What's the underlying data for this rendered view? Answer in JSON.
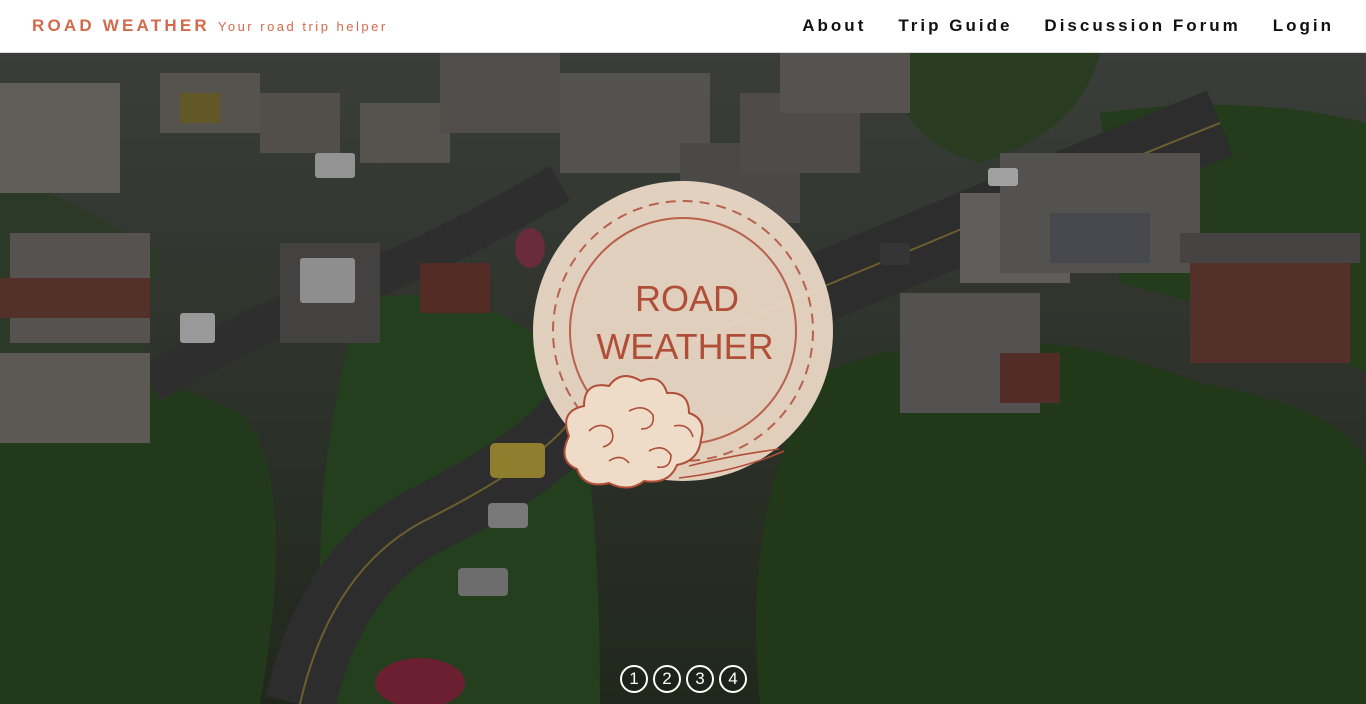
{
  "brand": {
    "name": "ROAD WEATHER",
    "tagline": "Your road trip helper",
    "color": "#d46a4b"
  },
  "nav": {
    "items": [
      {
        "label": "About"
      },
      {
        "label": "Trip Guide"
      },
      {
        "label": "Discussion Forum"
      },
      {
        "label": "Login"
      }
    ]
  },
  "hero": {
    "logo": {
      "line1": "ROAD",
      "line2": "WEATHER",
      "icon": "cloud-badge-icon",
      "fill_color": "#efdcc8",
      "ink_color": "#b04e38"
    },
    "background": "aerial-mountain-road-village-photo"
  },
  "pager": {
    "pages": [
      "1",
      "2",
      "3",
      "4"
    ]
  }
}
